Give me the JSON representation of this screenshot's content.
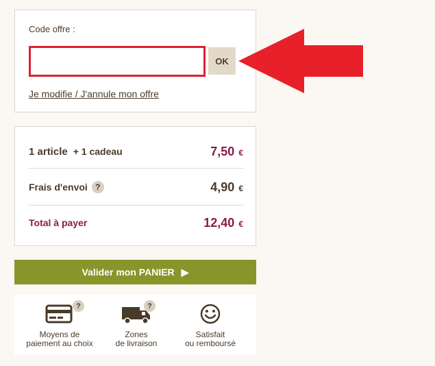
{
  "promo": {
    "label": "Code offre :",
    "input_value": "",
    "input_placeholder": "",
    "ok_label": "OK",
    "modify_link": "Je modifie / J'annule mon offre"
  },
  "summary": {
    "articles_label": "1 article",
    "gift_label": "+ 1 cadeau",
    "articles_amount": "7,50",
    "shipping_label": "Frais d'envoi",
    "shipping_help": "?",
    "shipping_amount": "4,90",
    "total_label": "Total à payer",
    "total_amount": "12,40",
    "currency": "€"
  },
  "validate": {
    "label": "Valider mon PANIER",
    "arrow": "▶"
  },
  "reassurance": {
    "items": [
      {
        "line1": "Moyens de",
        "line2": "paiement au choix",
        "icon": "credit-card-icon",
        "badge": "?"
      },
      {
        "line1": "Zones",
        "line2": "de livraison",
        "icon": "delivery-truck-icon",
        "badge": "?"
      },
      {
        "line1": "Satisfait",
        "line2": "ou remboursé",
        "icon": "smiley-icon"
      }
    ]
  },
  "colors": {
    "accent_price": "#8b1a4a",
    "validate_green": "#86962a",
    "highlight_red": "#e02030",
    "text_brown": "#4a3a2a"
  }
}
